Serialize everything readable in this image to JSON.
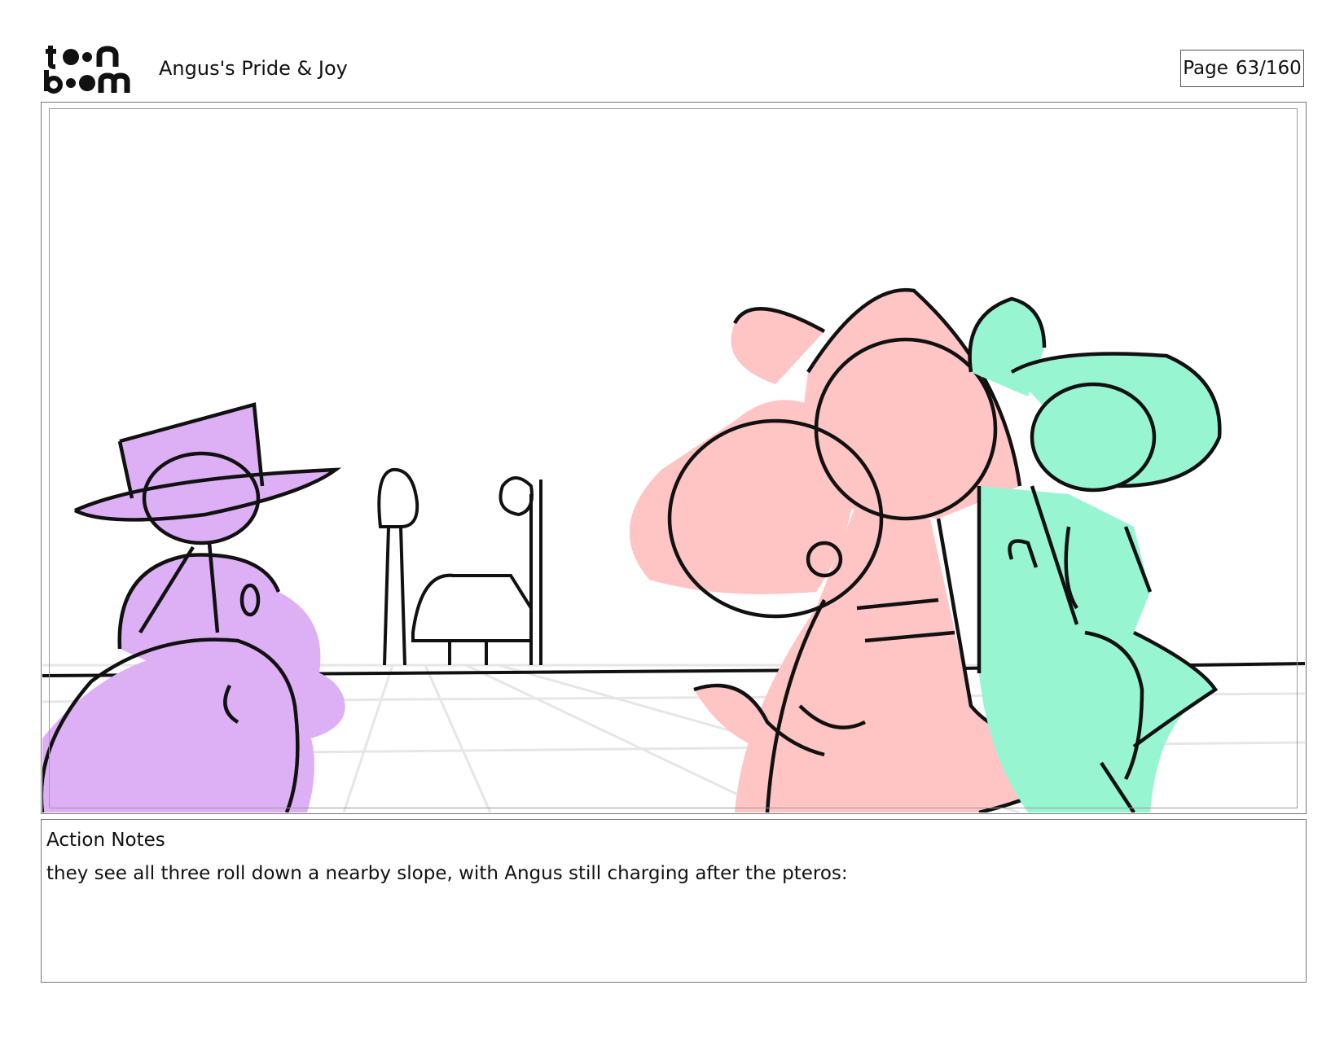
{
  "header": {
    "logo": {
      "line1": "toon",
      "line2": "boom"
    },
    "project_title": "Angus's Pride & Joy",
    "page_label": "Page",
    "page_number": "63/160"
  },
  "panel": {
    "image_icon": "storyboard-sketch-image",
    "fill_colors": {
      "purple_character": "#ddb0f6",
      "pink_character": "#ffc4c4",
      "green_character": "#97f5d2",
      "ink": "#111111",
      "ground_grid": "#e6e6e6"
    }
  },
  "notes": {
    "heading": "Action Notes",
    "text": "they see all three roll down a nearby slope, with Angus still charging after the pteros:"
  }
}
